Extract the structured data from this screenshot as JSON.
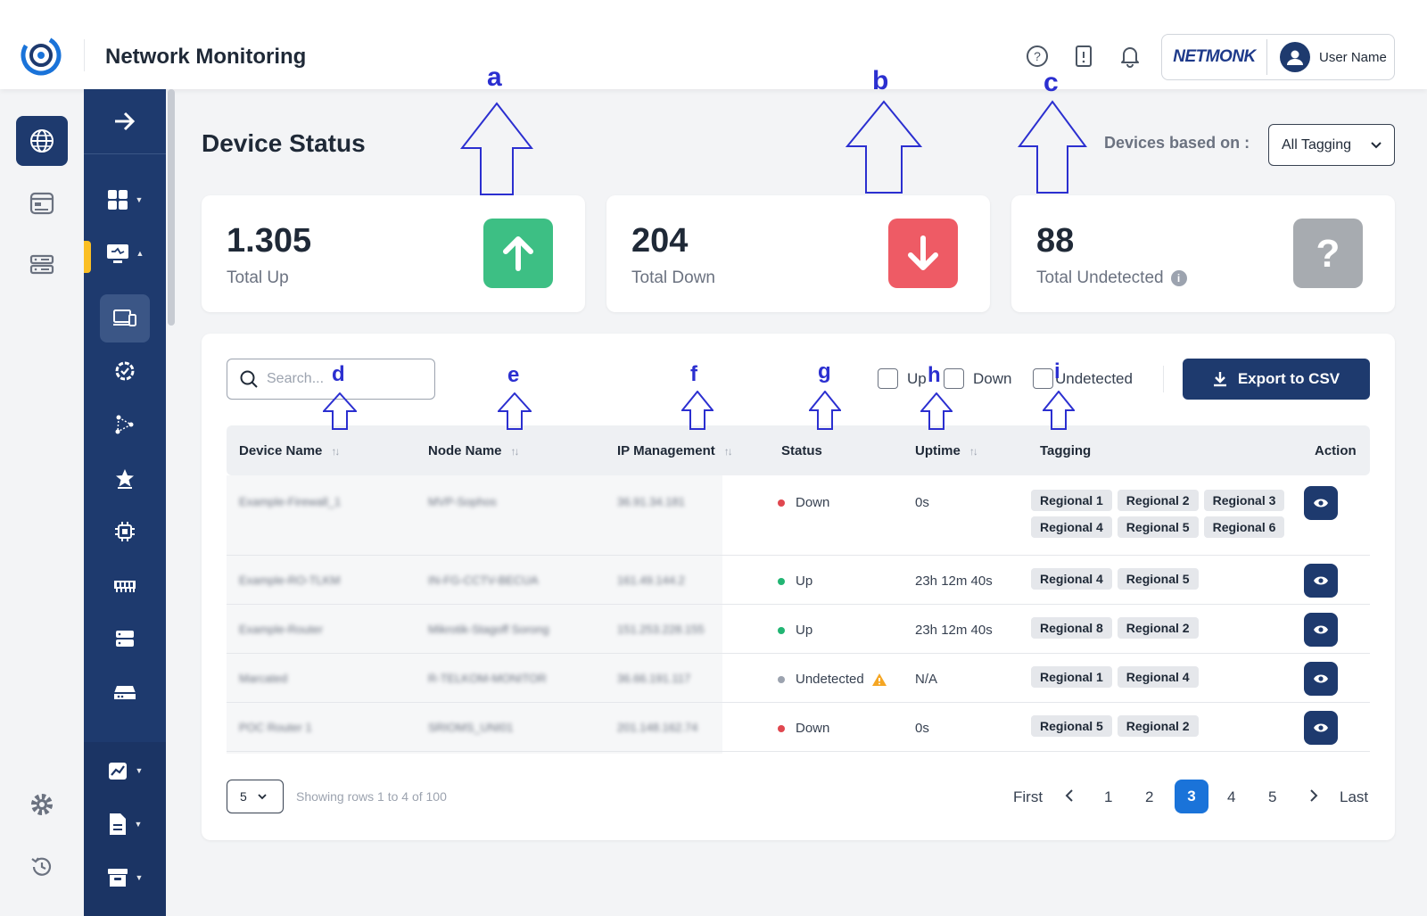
{
  "header": {
    "title": "Network Monitoring",
    "brand": "NETMONK",
    "user_name": "User Name",
    "icons": [
      "help-icon",
      "book-icon",
      "bell-icon"
    ]
  },
  "page": {
    "title": "Device Status",
    "filter_label": "Devices based on :",
    "filter_value": "All Tagging"
  },
  "cards": [
    {
      "value": "1.305",
      "label": "Total Up",
      "color": "#3dbf84",
      "icon": "arrow-up-icon"
    },
    {
      "value": "204",
      "label": "Total Down",
      "color": "#ee5b65",
      "icon": "arrow-down-icon"
    },
    {
      "value": "88",
      "label": "Total Undetected",
      "color": "#a7abb0",
      "icon": "question-icon"
    }
  ],
  "toolbar": {
    "search_placeholder": "Search...",
    "filter_up": "Up",
    "filter_down": "Down",
    "filter_undetected": "Undetected",
    "export_label": "Export to CSV"
  },
  "table": {
    "columns": [
      "Device Name",
      "Node Name",
      "IP Management",
      "Status",
      "Uptime",
      "Tagging",
      "Action"
    ],
    "rows": [
      {
        "device": "Example-Firewall_1",
        "node": "MVP-Sophos",
        "ip": "36.91.34.181",
        "status": "Down",
        "uptime": "0s",
        "tags": [
          "Regional 1",
          "Regional 2",
          "Regional 3",
          "Regional 4",
          "Regional 5",
          "Regional 6"
        ]
      },
      {
        "device": "Example-RO-TLKM",
        "node": "IN-FG-CCTV-BECUA",
        "ip": "161.49.144.2",
        "status": "Up",
        "uptime": "23h 12m 40s",
        "tags": [
          "Regional 4",
          "Regional 5"
        ]
      },
      {
        "device": "Example-Router",
        "node": "Mikrotik-Stagoff Sorong",
        "ip": "151.253.228.155",
        "status": "Up",
        "uptime": "23h 12m 40s",
        "tags": [
          "Regional 8",
          "Regional 2"
        ]
      },
      {
        "device": "Marcated",
        "node": "R-TELKOM-MONITOR",
        "ip": "36.66.191.117",
        "status": "Undetected",
        "uptime": "N/A",
        "tags": [
          "Regional 1",
          "Regional 4"
        ]
      },
      {
        "device": "POC Router 1",
        "node": "SRIOMS_UNI01",
        "ip": "201.148.162.74",
        "status": "Down",
        "uptime": "0s",
        "tags": [
          "Regional 5",
          "Regional 2"
        ]
      }
    ]
  },
  "status_colors": {
    "Down": "#e0474f",
    "Up": "#22b573",
    "Undetected": "#9ca3af",
    "warning": "#f5a623"
  },
  "pagination": {
    "rows_per_page": "5",
    "showing": "Showing rows 1 to 4 of 100",
    "first": "First",
    "last": "Last",
    "pages": [
      "1",
      "2",
      "3",
      "4",
      "5"
    ],
    "current": "3"
  },
  "annotations": [
    "a",
    "b",
    "c",
    "d",
    "e",
    "f",
    "g",
    "h",
    "i"
  ],
  "colors": {
    "primary": "#1e3a6e",
    "accent": "#1a73d9",
    "sidebar_marker": "#fbbf24"
  }
}
